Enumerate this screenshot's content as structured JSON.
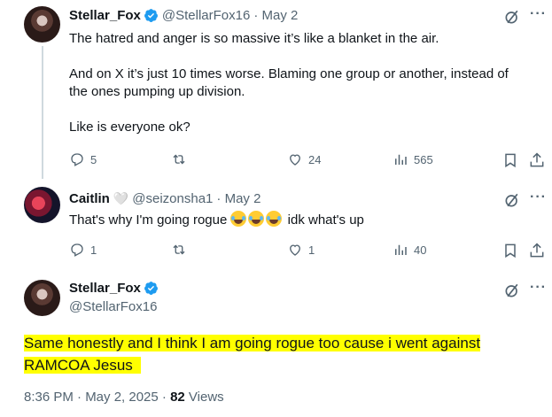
{
  "tweets": [
    {
      "name": "Stellar_Fox",
      "handle": "@StellarFox16",
      "date": "· May 2",
      "lines": [
        "The hatred and anger is so massive it’s like a blanket in the air.",
        "And on X it’s just 10 times worse. Blaming one group or another, instead of",
        "the ones pumping up division.",
        "Like is everyone ok?"
      ],
      "replies": "5",
      "reposts": "",
      "likes": "24",
      "views": "565"
    },
    {
      "name": "Caitlin",
      "handle": "@seizonsha1",
      "date": "· May 2",
      "text_before": "That's why I'm going rogue ",
      "text_after": " idk what's up",
      "replies": "1",
      "reposts": "",
      "likes": "1",
      "views": "40"
    }
  ],
  "main_tweet": {
    "name": "Stellar_Fox",
    "handle": "@StellarFox16",
    "line1": "Same honestly and I think I am going rogue too cause i went against",
    "line2": "RAMCOA Jesus",
    "time": "8:36 PM · May 2, 2025 · ",
    "views_count": "82",
    "views_label": " Views"
  },
  "colors": {
    "verified": "#1d9bf0",
    "highlight": "#ffff00",
    "muted": "#536471"
  },
  "icons": [
    "verified-badge-icon",
    "grok-icon",
    "more-icon",
    "reply-icon",
    "repost-icon",
    "like-icon",
    "views-icon",
    "bookmark-icon",
    "share-icon"
  ]
}
